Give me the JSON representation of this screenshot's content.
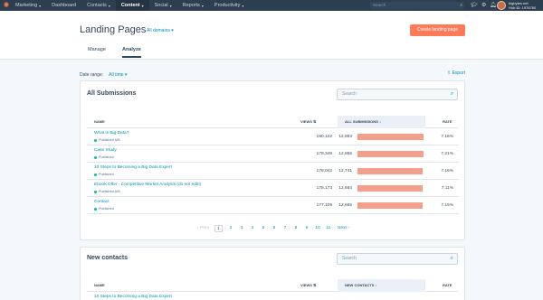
{
  "topnav": {
    "items": [
      {
        "label": "Marketing"
      },
      {
        "label": "Dashboard"
      },
      {
        "label": "Contacts"
      },
      {
        "label": "Content"
      },
      {
        "label": "Social"
      },
      {
        "label": "Reports"
      },
      {
        "label": "Productivity"
      }
    ],
    "search_placeholder": "Search",
    "account_name": "bigbytes.net",
    "hub_id": "Hub ID: 1976760"
  },
  "header": {
    "title": "Landing Pages",
    "domains_label": "All domains",
    "create_label": "Create landing page",
    "tabs": [
      {
        "label": "Manage"
      },
      {
        "label": "Analyze"
      }
    ]
  },
  "toolbar": {
    "date_range_label": "Date range:",
    "date_range_value": "All time",
    "export_label": "Export"
  },
  "submissions": {
    "title": "All Submissions",
    "search_placeholder": "Search",
    "columns": {
      "name": "NAME",
      "views": "VIEWS",
      "subs": "ALL SUBMISSIONS",
      "rate": "RATE"
    },
    "rows": [
      {
        "name": "What is Big Data?",
        "status": "Published A/B",
        "views": "180,122",
        "subs": "12,893",
        "pct": 1.0,
        "rate": "7.16%"
      },
      {
        "name": "Case Study",
        "status": "Published",
        "views": "178,349",
        "subs": "12,856",
        "pct": 0.997,
        "rate": "7.21%"
      },
      {
        "name": "10 Steps to Becoming a Big Data Expert",
        "status": "Published",
        "views": "178,042",
        "subs": "12,741",
        "pct": 0.988,
        "rate": "7.16%"
      },
      {
        "name": "Ebook Offer - Competitive Market Analysis (do not edit!)",
        "status": "Published A/B",
        "views": "178,173",
        "subs": "12,664",
        "pct": 0.982,
        "rate": "7.11%"
      },
      {
        "name": "Contact",
        "status": "Published",
        "views": "177,109",
        "subs": "12,655",
        "pct": 0.981,
        "rate": "7.15%"
      }
    ],
    "pager": {
      "prev": "Prev",
      "pages": [
        "1",
        "2",
        "3",
        "4",
        "5",
        "6",
        "7",
        "8",
        "9",
        "10",
        "11"
      ],
      "next": "Next"
    }
  },
  "contacts": {
    "title": "New contacts",
    "search_placeholder": "Search",
    "columns": {
      "name": "NAME",
      "views": "VIEWS",
      "subs": "NEW CONTACTS",
      "rate": "RATE"
    },
    "first_row_name": "10 Steps to Becoming a Big Data Expert"
  },
  "colors": {
    "accent": "#ff7a59",
    "bar": "#f2a08c",
    "nav_bg": "#2d3e50",
    "link": "#0091ae"
  }
}
